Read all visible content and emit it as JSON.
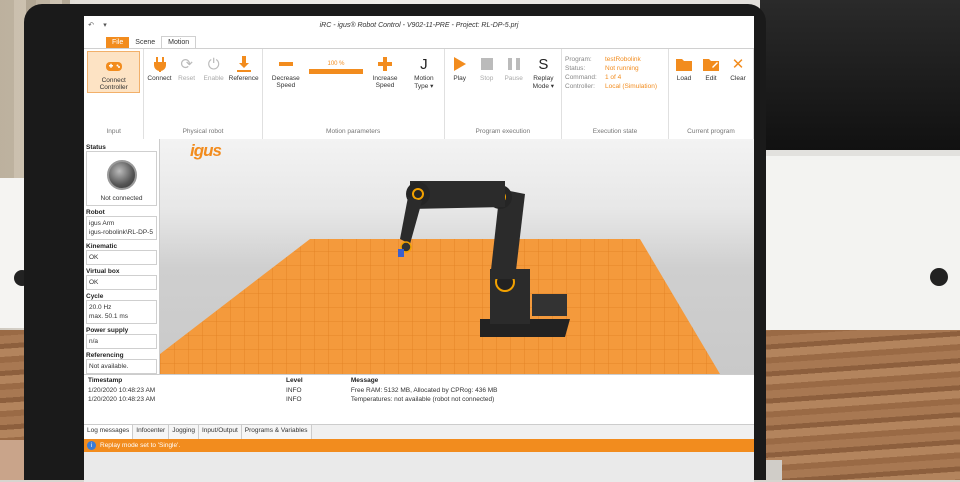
{
  "window": {
    "title": "iRC - igus® Robot Control  -  V902-11-PRE  -  Project: RL-DP-5.prj",
    "quick_access": [
      "↶",
      "▾"
    ]
  },
  "tabs": [
    {
      "label": "File"
    },
    {
      "label": "Scene"
    },
    {
      "label": "Motion"
    }
  ],
  "ribbon": {
    "input": {
      "label": "Input",
      "connect_controller": "Connect Controller"
    },
    "physical_robot": {
      "label": "Physical robot",
      "connect": "Connect",
      "reset": "Reset",
      "enable": "Enable",
      "reference": "Reference"
    },
    "motion_parameters": {
      "label": "Motion parameters",
      "decrease_speed": "Decrease Speed",
      "speed_value": "100 %",
      "speed_fraction": 1.0,
      "increase_speed": "Increase Speed",
      "motion_type": "Motion Type ▾",
      "motion_type_glyph": "J"
    },
    "program_execution": {
      "label": "Program execution",
      "play": "Play",
      "stop": "Stop",
      "pause": "Pause",
      "replay_mode": "Replay Mode ▾",
      "replay_glyph": "S"
    },
    "execution_state": {
      "label": "Execution state",
      "rows": [
        {
          "key": "Program:",
          "value": "testRobolink"
        },
        {
          "key": "Status:",
          "value": "Not running"
        },
        {
          "key": "Command:",
          "value": "1 of 4"
        },
        {
          "key": "Controller:",
          "value": "Local (Simulation)"
        }
      ]
    },
    "current_program": {
      "label": "Current program",
      "load": "Load",
      "edit": "Edit",
      "clear": "Clear"
    }
  },
  "status_panel": {
    "title": "Status",
    "connection": "Not connected",
    "sections": [
      {
        "head": "Robot",
        "lines": [
          "igus Arm",
          "igus-robolink\\RL-DP-5"
        ]
      },
      {
        "head": "Kinematic",
        "lines": [
          "OK"
        ]
      },
      {
        "head": "Virtual box",
        "lines": [
          "OK"
        ]
      },
      {
        "head": "Cycle",
        "lines": [
          "20.0 Hz",
          "max. 50.1 ms"
        ]
      },
      {
        "head": "Power supply",
        "lines": [
          "n/a"
        ]
      },
      {
        "head": "Referencing",
        "lines": [
          "Not available."
        ]
      }
    ]
  },
  "viewport": {
    "logo": "igus"
  },
  "log": {
    "columns": [
      "Timestamp",
      "Level",
      "Message"
    ],
    "rows": [
      {
        "timestamp": "1/20/2020 10:48:23 AM",
        "level": "INFO",
        "message": "Free RAM: 5132 MB, Allocated by CPRog: 436 MB"
      },
      {
        "timestamp": "1/20/2020 10:48:23 AM",
        "level": "INFO",
        "message": "Temperatures:  not available (robot not connected)"
      }
    ]
  },
  "bottom_tabs": [
    "Log messages",
    "Infocenter",
    "Jogging",
    "Input/Output",
    "Programs & Variables"
  ],
  "status_bar": {
    "message": "Replay mode set to 'Single'."
  },
  "colors": {
    "accent": "#f28c1e",
    "robot": "#2b2b2b"
  }
}
